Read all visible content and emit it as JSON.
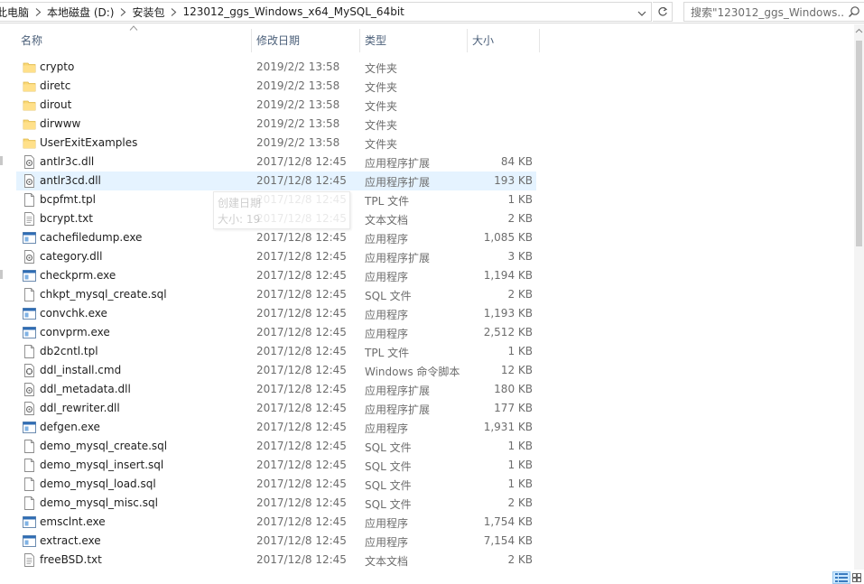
{
  "address": {
    "crumbs": [
      "此电脑",
      "本地磁盘 (D:)",
      "安装包",
      "123012_ggs_Windows_x64_MySQL_64bit"
    ]
  },
  "search": {
    "placeholder": "搜索\"123012_ggs_Windows..."
  },
  "columns": {
    "name": "名称",
    "date": "修改日期",
    "type": "类型",
    "size": "大小"
  },
  "tooltip": {
    "line1": "创建日期",
    "line2": "大小: 19"
  },
  "files": [
    {
      "name": "crypto",
      "date": "2019/2/2 13:58",
      "type": "文件夹",
      "size": "",
      "icon": "folder-icon"
    },
    {
      "name": "diretc",
      "date": "2019/2/2 13:58",
      "type": "文件夹",
      "size": "",
      "icon": "folder-icon"
    },
    {
      "name": "dirout",
      "date": "2019/2/2 13:58",
      "type": "文件夹",
      "size": "",
      "icon": "folder-icon"
    },
    {
      "name": "dirwww",
      "date": "2019/2/2 13:58",
      "type": "文件夹",
      "size": "",
      "icon": "folder-icon"
    },
    {
      "name": "UserExitExamples",
      "date": "2019/2/2 13:58",
      "type": "文件夹",
      "size": "",
      "icon": "folder-icon"
    },
    {
      "name": "antlr3c.dll",
      "date": "2017/12/8 12:45",
      "type": "应用程序扩展",
      "size": "84 KB",
      "icon": "dll-icon"
    },
    {
      "name": "antlr3cd.dll",
      "date": "2017/12/8 12:45",
      "type": "应用程序扩展",
      "size": "193 KB",
      "icon": "dll-icon"
    },
    {
      "name": "bcpfmt.tpl",
      "date": "2017/12/8 12:45",
      "type": "TPL 文件",
      "size": "1 KB",
      "icon": "file-icon"
    },
    {
      "name": "bcrypt.txt",
      "date": "2017/12/8 12:45",
      "type": "文本文档",
      "size": "2 KB",
      "icon": "text-file-icon"
    },
    {
      "name": "cachefiledump.exe",
      "date": "2017/12/8 12:45",
      "type": "应用程序",
      "size": "1,085 KB",
      "icon": "exe-icon"
    },
    {
      "name": "category.dll",
      "date": "2017/12/8 12:45",
      "type": "应用程序扩展",
      "size": "3 KB",
      "icon": "dll-icon"
    },
    {
      "name": "checkprm.exe",
      "date": "2017/12/8 12:45",
      "type": "应用程序",
      "size": "1,194 KB",
      "icon": "exe-icon"
    },
    {
      "name": "chkpt_mysql_create.sql",
      "date": "2017/12/8 12:45",
      "type": "SQL 文件",
      "size": "2 KB",
      "icon": "file-icon"
    },
    {
      "name": "convchk.exe",
      "date": "2017/12/8 12:45",
      "type": "应用程序",
      "size": "1,193 KB",
      "icon": "exe-icon"
    },
    {
      "name": "convprm.exe",
      "date": "2017/12/8 12:45",
      "type": "应用程序",
      "size": "2,512 KB",
      "icon": "exe-icon"
    },
    {
      "name": "db2cntl.tpl",
      "date": "2017/12/8 12:45",
      "type": "TPL 文件",
      "size": "1 KB",
      "icon": "file-icon"
    },
    {
      "name": "ddl_install.cmd",
      "date": "2017/12/8 12:45",
      "type": "Windows 命令脚本",
      "size": "12 KB",
      "icon": "cmd-icon"
    },
    {
      "name": "ddl_metadata.dll",
      "date": "2017/12/8 12:45",
      "type": "应用程序扩展",
      "size": "180 KB",
      "icon": "dll-icon"
    },
    {
      "name": "ddl_rewriter.dll",
      "date": "2017/12/8 12:45",
      "type": "应用程序扩展",
      "size": "177 KB",
      "icon": "dll-icon"
    },
    {
      "name": "defgen.exe",
      "date": "2017/12/8 12:45",
      "type": "应用程序",
      "size": "1,931 KB",
      "icon": "exe-icon"
    },
    {
      "name": "demo_mysql_create.sql",
      "date": "2017/12/8 12:45",
      "type": "SQL 文件",
      "size": "1 KB",
      "icon": "file-icon"
    },
    {
      "name": "demo_mysql_insert.sql",
      "date": "2017/12/8 12:45",
      "type": "SQL 文件",
      "size": "1 KB",
      "icon": "file-icon"
    },
    {
      "name": "demo_mysql_load.sql",
      "date": "2017/12/8 12:45",
      "type": "SQL 文件",
      "size": "1 KB",
      "icon": "file-icon"
    },
    {
      "name": "demo_mysql_misc.sql",
      "date": "2017/12/8 12:45",
      "type": "SQL 文件",
      "size": "2 KB",
      "icon": "file-icon"
    },
    {
      "name": "emsclnt.exe",
      "date": "2017/12/8 12:45",
      "type": "应用程序",
      "size": "1,754 KB",
      "icon": "exe-icon"
    },
    {
      "name": "extract.exe",
      "date": "2017/12/8 12:45",
      "type": "应用程序",
      "size": "7,154 KB",
      "icon": "exe-icon"
    },
    {
      "name": "freeBSD.txt",
      "date": "2017/12/8 12:45",
      "type": "文本文档",
      "size": "2 KB",
      "icon": "text-file-icon"
    }
  ],
  "hovered_file": "antlr3cd.dll",
  "colors": {
    "hover_row": "#e5f3ff",
    "folder": "#f8d775",
    "header_text": "#4c607a",
    "exe_blue": "#1e73be"
  }
}
